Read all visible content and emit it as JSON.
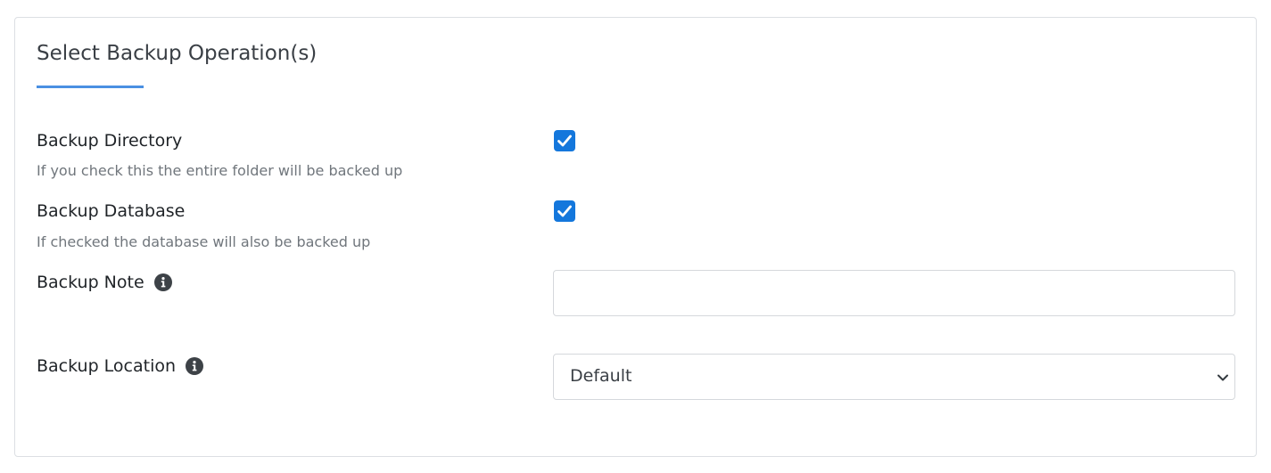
{
  "section": {
    "title": "Select Backup Operation(s)"
  },
  "fields": {
    "backup_directory": {
      "label": "Backup Directory",
      "help": "If you check this the entire folder will be backed up",
      "checked": true
    },
    "backup_database": {
      "label": "Backup Database",
      "help": "If checked the database will also be backed up",
      "checked": true
    },
    "backup_note": {
      "label": "Backup Note",
      "value": "",
      "icon": "info-icon"
    },
    "backup_location": {
      "label": "Backup Location",
      "selected": "Default",
      "icon": "info-icon"
    }
  },
  "colors": {
    "accent": "#4a90e2",
    "checkbox": "#1477dc",
    "help_text": "#70767c"
  }
}
